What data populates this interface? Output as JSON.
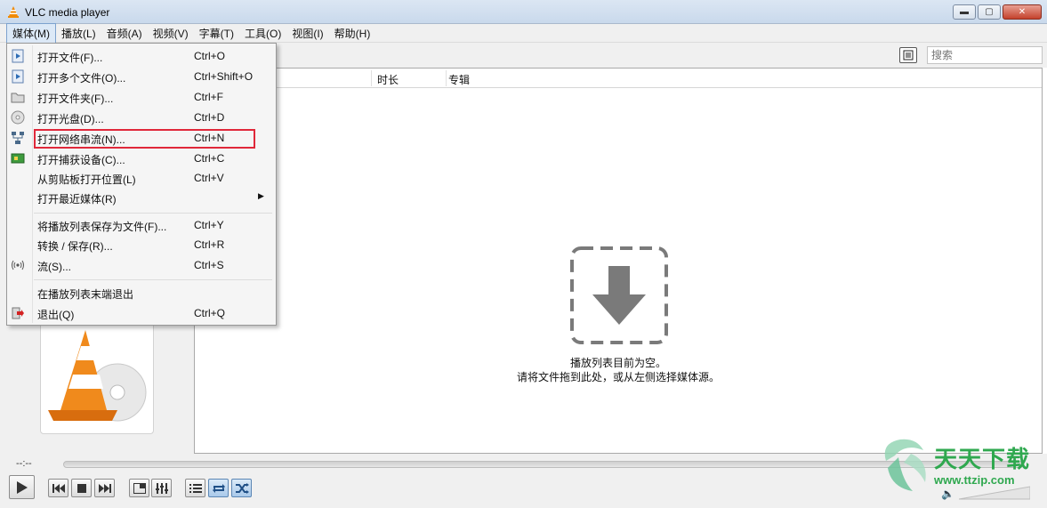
{
  "window": {
    "title": "VLC media player",
    "minimize_glyph": "▬",
    "maximize_glyph": "▢",
    "close_glyph": "✕"
  },
  "menubar": [
    {
      "label": "媒体(M)",
      "active": true
    },
    {
      "label": "播放(L)"
    },
    {
      "label": "音频(A)"
    },
    {
      "label": "视频(V)"
    },
    {
      "label": "字幕(T)"
    },
    {
      "label": "工具(O)"
    },
    {
      "label": "视图(I)"
    },
    {
      "label": "帮助(H)"
    }
  ],
  "search": {
    "placeholder": "搜索"
  },
  "playlist": {
    "columns": [
      "时长",
      "专辑"
    ],
    "empty_line1": "播放列表目前为空。",
    "empty_line2": "请将文件拖到此处，或从左侧选择媒体源。"
  },
  "media_menu": {
    "items": [
      {
        "label": "打开文件(F)...",
        "shortcut": "Ctrl+O",
        "icon": "file-play-icon"
      },
      {
        "label": "打开多个文件(O)...",
        "shortcut": "Ctrl+Shift+O",
        "icon": "files-play-icon"
      },
      {
        "label": "打开文件夹(F)...",
        "shortcut": "Ctrl+F",
        "icon": "folder-icon"
      },
      {
        "label": "打开光盘(D)...",
        "shortcut": "Ctrl+D",
        "icon": "disc-icon"
      },
      {
        "label": "打开网络串流(N)...",
        "shortcut": "Ctrl+N",
        "icon": "network-icon",
        "highlighted": true
      },
      {
        "label": "打开捕获设备(C)...",
        "shortcut": "Ctrl+C",
        "icon": "capture-card-icon"
      },
      {
        "label": "从剪贴板打开位置(L)",
        "shortcut": "Ctrl+V",
        "icon": ""
      },
      {
        "label": "打开最近媒体(R)",
        "shortcut": "",
        "icon": "",
        "submenu": true
      },
      {
        "label": "将播放列表保存为文件(F)...",
        "shortcut": "Ctrl+Y",
        "icon": ""
      },
      {
        "label": "转换 / 保存(R)...",
        "shortcut": "Ctrl+R",
        "icon": ""
      },
      {
        "label": "流(S)...",
        "shortcut": "Ctrl+S",
        "icon": "stream-icon"
      },
      {
        "label": "在播放列表末端退出",
        "shortcut": "",
        "icon": ""
      },
      {
        "label": "退出(Q)",
        "shortcut": "Ctrl+Q",
        "icon": "exit-icon"
      }
    ]
  },
  "controls": {
    "time_elapsed": "--:--",
    "time_total": "--:--"
  },
  "watermark": {
    "text": "天天下载",
    "url": "www.ttzip.com"
  }
}
